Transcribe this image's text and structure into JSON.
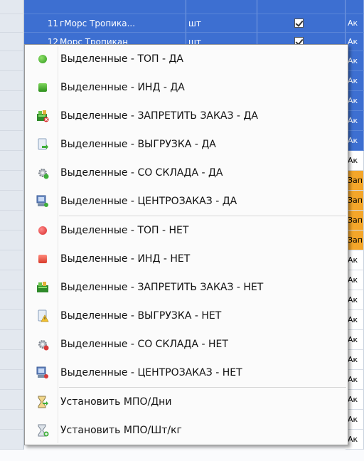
{
  "grid": {
    "rows": [
      {
        "num": "11",
        "name": "гМорс Тропика...",
        "unit": "шт",
        "last": "Ак",
        "selected": true
      },
      {
        "num": "12",
        "name": "Морс Тропикан",
        "unit": "шт",
        "last": "Ак",
        "selected": true
      }
    ],
    "side_cells": [
      "Ак",
      "Ак",
      "Ак",
      "Ак",
      "Ак",
      "Ак",
      "Зап",
      "Зап",
      "Зап",
      "Зап",
      "Ак",
      "Ак",
      "Ак",
      "Ак",
      "Ак",
      "Ак",
      "Ак",
      "Ак",
      "Ак",
      "Ак"
    ]
  },
  "menu": {
    "items": [
      {
        "label": "Выделенные - ТОП - ДА",
        "icon": "green-circle-icon"
      },
      {
        "label": "Выделенные - ИНД - ДА",
        "icon": "green-square-icon"
      },
      {
        "label": "Выделенные - ЗАПРЕТИТЬ ЗАКАЗ - ДА",
        "icon": "block-order-icon"
      },
      {
        "label": "Выделенные - ВЫГРУЗКА - ДА",
        "icon": "export-icon"
      },
      {
        "label": "Выделенные - СО СКЛАДА - ДА",
        "icon": "warehouse-gear-icon"
      },
      {
        "label": "Выделенные - ЦЕНТРОЗАКАЗ - ДА",
        "icon": "central-order-icon"
      },
      {
        "label": "Выделенные - ТОП - НЕТ",
        "icon": "red-circle-icon"
      },
      {
        "label": "Выделенные - ИНД - НЕТ",
        "icon": "red-square-icon"
      },
      {
        "label": "Выделенные - ЗАПРЕТИТЬ ЗАКАЗ - НЕТ",
        "icon": "allow-order-icon"
      },
      {
        "label": "Выделенные - ВЫГРУЗКА - НЕТ",
        "icon": "export-warning-icon"
      },
      {
        "label": "Выделенные - СО СКЛАДА - НЕТ",
        "icon": "warehouse-gear-off-icon"
      },
      {
        "label": "Выделенные - ЦЕНТРОЗАКАЗ - НЕТ",
        "icon": "central-order-off-icon"
      },
      {
        "label": "Установить МПО/Дни",
        "icon": "hourglass-arrow-icon"
      },
      {
        "label": "Установить МПО/Шт/кг",
        "icon": "hourglass-plus-icon"
      }
    ]
  }
}
